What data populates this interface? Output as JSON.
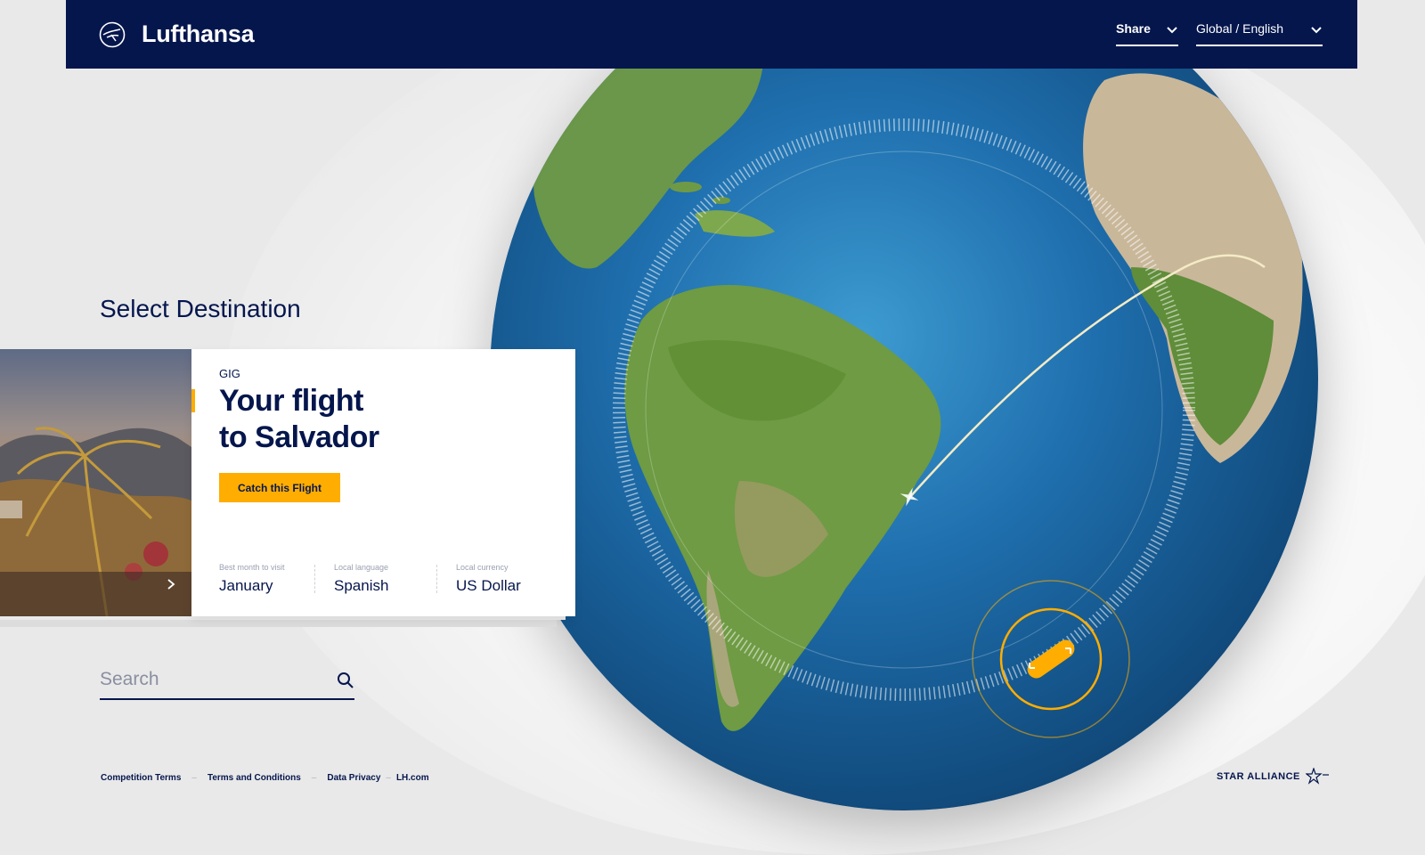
{
  "header": {
    "brand": "Lufthansa",
    "share_label": "Share",
    "language_label": "Global / English"
  },
  "main": {
    "section_title": "Select Destination"
  },
  "destination_card": {
    "code": "GIG",
    "title_line1": "Your flight",
    "title_line2": "to Salvador",
    "cta_label": "Catch this Flight",
    "info": [
      {
        "label": "Best month to visit",
        "value": "January"
      },
      {
        "label": "Local language",
        "value": "Spanish"
      },
      {
        "label": "Local currency",
        "value": "US Dollar"
      }
    ]
  },
  "search": {
    "placeholder": "Search"
  },
  "footer": {
    "links": [
      "Competition Terms",
      "Terms and Conditions",
      "Data Privacy",
      "LH.com"
    ],
    "alliance": "STAR ALLIANCE"
  },
  "colors": {
    "navy": "#05164d",
    "accent": "#ffad00"
  },
  "icons": [
    "crane-logo-icon",
    "chevron-down-icon",
    "search-icon",
    "chevron-right-icon",
    "plane-icon",
    "zoom-handle-icon",
    "star-alliance-icon"
  ]
}
